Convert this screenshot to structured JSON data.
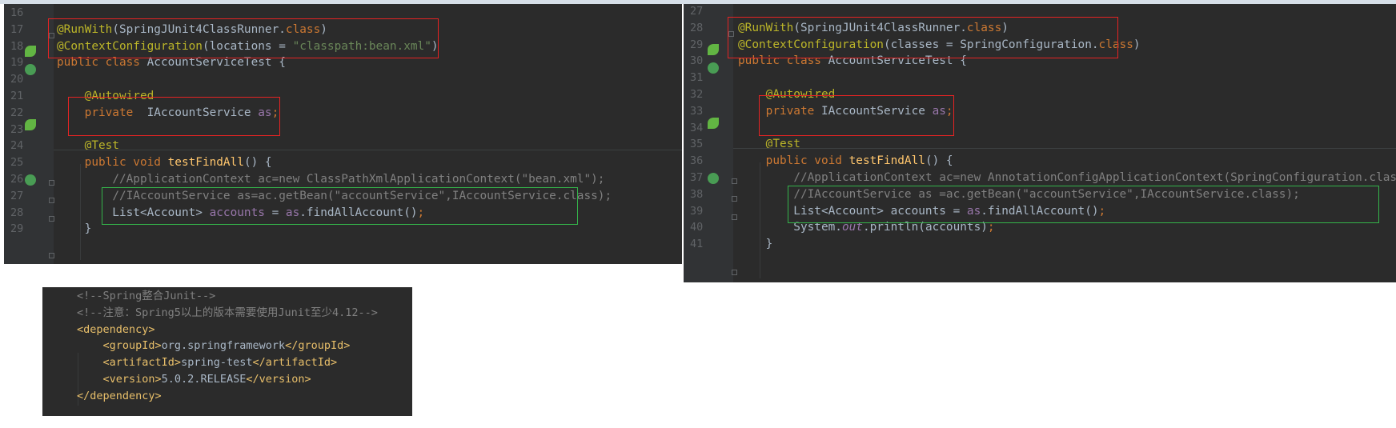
{
  "left_editor": {
    "lines": [
      {
        "num": "16",
        "segments": []
      },
      {
        "num": "17",
        "segments": [
          {
            "c": "ann",
            "t": "@RunWith"
          },
          {
            "c": "",
            "t": "(SpringJUnit4ClassRunner."
          },
          {
            "c": "kw",
            "t": "class"
          },
          {
            "c": "",
            "t": ")"
          }
        ]
      },
      {
        "num": "18",
        "segments": [
          {
            "c": "ann",
            "t": "@ContextConfiguration"
          },
          {
            "c": "",
            "t": "(locations = "
          },
          {
            "c": "str",
            "t": "\"classpath:bean.xml\""
          },
          {
            "c": "",
            "t": ")"
          }
        ]
      },
      {
        "num": "19",
        "segments": [
          {
            "c": "kw",
            "t": "public class "
          },
          {
            "c": "",
            "t": "AccountServiceTest {"
          }
        ]
      },
      {
        "num": "20",
        "segments": []
      },
      {
        "num": "21",
        "segments": [
          {
            "c": "",
            "t": "    "
          },
          {
            "c": "ann",
            "t": "@Autowired"
          }
        ]
      },
      {
        "num": "22",
        "segments": [
          {
            "c": "",
            "t": "    "
          },
          {
            "c": "kw",
            "t": "private  "
          },
          {
            "c": "",
            "t": "IAccountService "
          },
          {
            "c": "fld",
            "t": "as"
          },
          {
            "c": "kw",
            "t": ";"
          }
        ]
      },
      {
        "num": "23",
        "segments": []
      },
      {
        "num": "24",
        "segments": [
          {
            "c": "",
            "t": "    "
          },
          {
            "c": "ann",
            "t": "@Test"
          }
        ]
      },
      {
        "num": "25",
        "segments": [
          {
            "c": "",
            "t": "    "
          },
          {
            "c": "kw",
            "t": "public void "
          },
          {
            "c": "fn",
            "t": "testFindAll"
          },
          {
            "c": "",
            "t": "() {"
          }
        ]
      },
      {
        "num": "26",
        "segments": [
          {
            "c": "",
            "t": "        "
          },
          {
            "c": "cmt",
            "t": "//ApplicationContext ac=new ClassPathXmlApplicationContext(\"bean.xml\");"
          }
        ]
      },
      {
        "num": "27",
        "segments": [
          {
            "c": "",
            "t": "        "
          },
          {
            "c": "cmt",
            "t": "//IAccountService as=ac.getBean(\"accountService\",IAccountService.class);"
          }
        ]
      },
      {
        "num": "28",
        "segments": [
          {
            "c": "",
            "t": "        List<Account> "
          },
          {
            "c": "fld",
            "t": "accounts"
          },
          {
            "c": "",
            "t": " = "
          },
          {
            "c": "fld",
            "t": "as"
          },
          {
            "c": "",
            "t": ".findAllAccount()"
          },
          {
            "c": "kw",
            "t": ";"
          }
        ]
      },
      {
        "num": "29",
        "segments": [
          {
            "c": "",
            "t": "    }"
          }
        ]
      }
    ]
  },
  "right_editor": {
    "lines": [
      {
        "num": "27",
        "segments": []
      },
      {
        "num": "28",
        "segments": [
          {
            "c": "ann",
            "t": "@RunWith"
          },
          {
            "c": "",
            "t": "(SpringJUnit4ClassRunner."
          },
          {
            "c": "kw",
            "t": "class"
          },
          {
            "c": "",
            "t": ")"
          }
        ]
      },
      {
        "num": "29",
        "segments": [
          {
            "c": "ann",
            "t": "@ContextConfiguration"
          },
          {
            "c": "",
            "t": "(classes = SpringConfiguration."
          },
          {
            "c": "kw",
            "t": "class"
          },
          {
            "c": "",
            "t": ")"
          }
        ]
      },
      {
        "num": "30",
        "segments": [
          {
            "c": "kw",
            "t": "public class "
          },
          {
            "c": "",
            "t": "AccountServiceTest {"
          }
        ]
      },
      {
        "num": "31",
        "segments": []
      },
      {
        "num": "32",
        "segments": [
          {
            "c": "",
            "t": "    "
          },
          {
            "c": "ann",
            "t": "@Autowired"
          }
        ]
      },
      {
        "num": "33",
        "segments": [
          {
            "c": "",
            "t": "    "
          },
          {
            "c": "kw",
            "t": "private "
          },
          {
            "c": "",
            "t": "IAccountService "
          },
          {
            "c": "fld",
            "t": "as"
          },
          {
            "c": "kw",
            "t": ";"
          }
        ]
      },
      {
        "num": "34",
        "segments": []
      },
      {
        "num": "35",
        "segments": [
          {
            "c": "",
            "t": "    "
          },
          {
            "c": "ann",
            "t": "@Test"
          }
        ]
      },
      {
        "num": "36",
        "segments": [
          {
            "c": "",
            "t": "    "
          },
          {
            "c": "kw",
            "t": "public void "
          },
          {
            "c": "fn",
            "t": "testFindAll"
          },
          {
            "c": "",
            "t": "() {"
          }
        ]
      },
      {
        "num": "37",
        "segments": [
          {
            "c": "",
            "t": "        "
          },
          {
            "c": "cmt",
            "t": "//ApplicationContext ac=new AnnotationConfigApplicationContext(SpringConfiguration.class);"
          }
        ]
      },
      {
        "num": "38",
        "segments": [
          {
            "c": "",
            "t": "        "
          },
          {
            "c": "cmt",
            "t": "//IAccountService as =ac.getBean(\"accountService\",IAccountService.class);"
          }
        ]
      },
      {
        "num": "39",
        "segments": [
          {
            "c": "",
            "t": "        List<Account> accounts = "
          },
          {
            "c": "fld",
            "t": "as"
          },
          {
            "c": "",
            "t": ".findAllAccount()"
          },
          {
            "c": "kw",
            "t": ";"
          }
        ]
      },
      {
        "num": "40",
        "segments": [
          {
            "c": "",
            "t": "        System."
          },
          {
            "c": "ital",
            "t": "out"
          },
          {
            "c": "",
            "t": ".println(accounts)"
          },
          {
            "c": "kw",
            "t": ";"
          }
        ]
      },
      {
        "num": "41",
        "segments": [
          {
            "c": "",
            "t": "    }"
          }
        ]
      }
    ]
  },
  "xml_editor": {
    "lines": [
      {
        "segments": [
          {
            "c": "xcmt",
            "t": "<!--Spring整合Junit-->"
          }
        ]
      },
      {
        "segments": [
          {
            "c": "xcmt",
            "t": "<!--注意：Spring5以上的版本需要使用Junit至少4.12-->"
          }
        ]
      },
      {
        "segments": [
          {
            "c": "tag",
            "t": "<dependency>"
          }
        ]
      },
      {
        "segments": [
          {
            "c": "",
            "t": "    "
          },
          {
            "c": "tag",
            "t": "<groupId>"
          },
          {
            "c": "",
            "t": "org.springframework"
          },
          {
            "c": "tag",
            "t": "</groupId>"
          }
        ]
      },
      {
        "segments": [
          {
            "c": "",
            "t": "    "
          },
          {
            "c": "tag",
            "t": "<artifactId>"
          },
          {
            "c": "",
            "t": "spring-test"
          },
          {
            "c": "tag",
            "t": "</artifactId>"
          }
        ]
      },
      {
        "segments": [
          {
            "c": "",
            "t": "    "
          },
          {
            "c": "tag",
            "t": "<version>"
          },
          {
            "c": "",
            "t": "5.0.2.RELEASE"
          },
          {
            "c": "tag",
            "t": "</version>"
          }
        ]
      },
      {
        "segments": [
          {
            "c": "tag",
            "t": "</dependency>"
          }
        ]
      }
    ]
  },
  "colors": {
    "editor_bg": "#2b2b2b",
    "gutter_bg": "#313335",
    "highlight_red": "#e52323",
    "highlight_green": "#34b34a"
  }
}
